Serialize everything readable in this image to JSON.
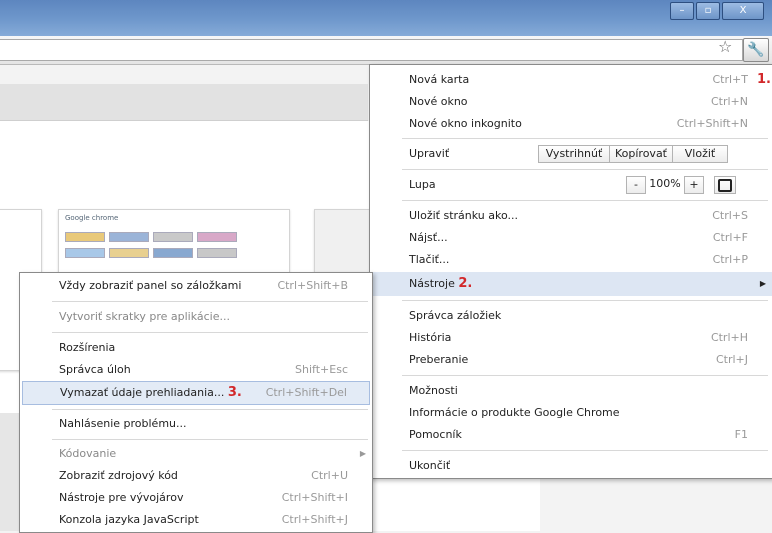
{
  "window": {
    "controls": [
      "–",
      "▫",
      "X"
    ]
  },
  "toolbar": {
    "star_icon": "☆",
    "wrench_icon": "🔧"
  },
  "main_menu": {
    "new_tab": {
      "label": "Nová karta",
      "shortcut": "Ctrl+T"
    },
    "new_window": {
      "label": "Nové okno",
      "shortcut": "Ctrl+N"
    },
    "incognito": {
      "label": "Nové okno inkognito",
      "shortcut": "Ctrl+Shift+N"
    },
    "edit": {
      "label": "Upraviť",
      "cut": "Vystrihnúť",
      "copy": "Kopírovať",
      "paste": "Vložiť"
    },
    "zoom": {
      "label": "Lupa",
      "minus": "-",
      "value": "100%",
      "plus": "+"
    },
    "save_page": {
      "label": "Uložiť stránku ako...",
      "shortcut": "Ctrl+S"
    },
    "find": {
      "label": "Nájsť...",
      "shortcut": "Ctrl+F"
    },
    "print": {
      "label": "Tlačiť...",
      "shortcut": "Ctrl+P"
    },
    "tools": {
      "label": "Nástroje"
    },
    "bookmark_manager": {
      "label": "Správca záložiek"
    },
    "history": {
      "label": "História",
      "shortcut": "Ctrl+H"
    },
    "downloads": {
      "label": "Preberanie",
      "shortcut": "Ctrl+J"
    },
    "options": {
      "label": "Možnosti"
    },
    "about": {
      "label": "Informácie o produkte Google Chrome"
    },
    "help": {
      "label": "Pomocník",
      "shortcut": "F1"
    },
    "exit": {
      "label": "Ukončiť"
    }
  },
  "sub_menu": {
    "bookmarks_bar": {
      "label": "Vždy zobraziť panel so záložkami",
      "shortcut": "Ctrl+Shift+B"
    },
    "app_shortcuts": {
      "label": "Vytvoriť skratky pre aplikácie..."
    },
    "extensions": {
      "label": "Rozšírenia"
    },
    "task_manager": {
      "label": "Správca úloh",
      "shortcut": "Shift+Esc"
    },
    "clear_data": {
      "label": "Vymazať údaje prehliadania...",
      "shortcut": "Ctrl+Shift+Del"
    },
    "report_issue": {
      "label": "Nahlásenie problému..."
    },
    "encoding": {
      "label": "Kódovanie"
    },
    "view_source": {
      "label": "Zobraziť zdrojový kód",
      "shortcut": "Ctrl+U"
    },
    "dev_tools": {
      "label": "Nástroje pre vývojárov",
      "shortcut": "Ctrl+Shift+I"
    },
    "js_console": {
      "label": "Konzola jazyka JavaScript",
      "shortcut": "Ctrl+Shift+J"
    }
  },
  "annotations": {
    "step1": "1.",
    "step2": "2.",
    "step3": "3."
  },
  "thumbnail": {
    "title": "Google chrome"
  },
  "colors": {
    "titlebar": "#6f98cc",
    "highlight": "#dde6f3",
    "step_marker": "#d2282a"
  }
}
